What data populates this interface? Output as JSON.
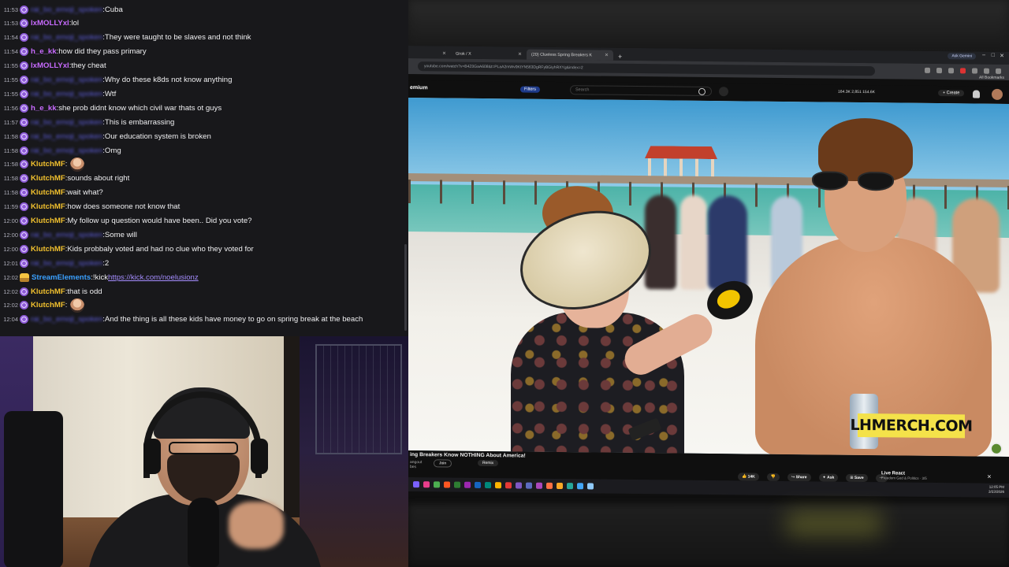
{
  "chat": {
    "messages": [
      {
        "time": "11:53",
        "user": "rai_bo_emoji_spoken",
        "hidden": true,
        "color": "#5b5bd6",
        "text": "Cuba"
      },
      {
        "time": "11:53",
        "user": "lxMOLLYxl",
        "hidden": false,
        "color": "#c86bff",
        "text": "lol"
      },
      {
        "time": "11:54",
        "user": "rai_bo_emoji_spoken",
        "hidden": true,
        "color": "#5b5bd6",
        "text": "They were taught to be slaves and not think"
      },
      {
        "time": "11:54",
        "user": "h_e_kk",
        "hidden": false,
        "color": "#c86bff",
        "text": "how did they pass primary"
      },
      {
        "time": "11:55",
        "user": "lxMOLLYxl",
        "hidden": false,
        "color": "#c86bff",
        "text": "they cheat"
      },
      {
        "time": "11:55",
        "user": "rai_bo_emoji_spoken",
        "hidden": true,
        "color": "#5b5bd6",
        "text": "Why do these k8ds not know anything"
      },
      {
        "time": "11:55",
        "user": "rai_bo_emoji_spoken",
        "hidden": true,
        "color": "#5b5bd6",
        "text": "Wtf"
      },
      {
        "time": "11:56",
        "user": "h_e_kk",
        "hidden": false,
        "color": "#c86bff",
        "text": "she prob didnt know which civil war thats ot guys"
      },
      {
        "time": "11:57",
        "user": "rai_bo_emoji_spoken",
        "hidden": true,
        "color": "#5b5bd6",
        "text": "This is embarrassing"
      },
      {
        "time": "11:58",
        "user": "rai_bo_emoji_spoken",
        "hidden": true,
        "color": "#5b5bd6",
        "text": "Our education system is broken"
      },
      {
        "time": "11:58",
        "user": "rai_bo_emoji_spoken",
        "hidden": true,
        "color": "#5b5bd6",
        "text": "Omg"
      },
      {
        "time": "11:58",
        "user": "KlutchMF",
        "hidden": false,
        "color": "#f2c12e",
        "text": "",
        "emote": true
      },
      {
        "time": "11:58",
        "user": "KlutchMF",
        "hidden": false,
        "color": "#f2c12e",
        "text": "sounds about right"
      },
      {
        "time": "11:58",
        "user": "KlutchMF",
        "hidden": false,
        "color": "#f2c12e",
        "text": "wait what?"
      },
      {
        "time": "11:59",
        "user": "KlutchMF",
        "hidden": false,
        "color": "#f2c12e",
        "text": "how does someone not know that"
      },
      {
        "time": "12:00",
        "user": "KlutchMF",
        "hidden": false,
        "color": "#f2c12e",
        "text": "My follow up question would have been.. Did you vote?"
      },
      {
        "time": "12:00",
        "user": "rai_bo_emoji_spoken",
        "hidden": true,
        "color": "#5b5bd6",
        "text": "Some will"
      },
      {
        "time": "12:00",
        "user": "KlutchMF",
        "hidden": false,
        "color": "#f2c12e",
        "text": "Kids probbaly voted and had no clue who they voted for"
      },
      {
        "time": "12:01",
        "user": "rai_bo_emoji_spoken",
        "hidden": true,
        "color": "#5b5bd6",
        "text": "2"
      },
      {
        "time": "12:02",
        "user": "StreamElements",
        "hidden": false,
        "color": "#3aa0ff",
        "text": "!kick",
        "link": "https://kick.com/noelusionz",
        "bot": true
      },
      {
        "time": "12:02",
        "user": "KlutchMF",
        "hidden": false,
        "color": "#f2c12e",
        "text": "that is odd"
      },
      {
        "time": "12:02",
        "user": "KlutchMF",
        "hidden": false,
        "color": "#f2c12e",
        "text": "",
        "emote": true
      },
      {
        "time": "12:04",
        "user": "rai_bo_emoji_spoken",
        "hidden": true,
        "color": "#5b5bd6",
        "text": "And the thing is all these kids have money to go on spring break at the beach"
      }
    ]
  },
  "browser": {
    "tabs": [
      {
        "label": "",
        "active": false
      },
      {
        "label": "Grok / X",
        "active": false
      },
      {
        "label": "(20) Clueless Spring Breakers K",
        "active": true
      }
    ],
    "ask_gemini": "Ask Gemini",
    "url": "youtube.com/watch?v=B4Z0GaA608&t=PLaA2mWv0KtYN563DgRFyBGiyhRXYg&index=2",
    "bookmarks": "All Bookmarks"
  },
  "youtube": {
    "logo_text": "emium",
    "filters": "Filters",
    "search_placeholder": "Search",
    "stats": "164.3K  2,851  154.6K",
    "create": "+ Create",
    "video_title": "ing Breakers Know NOTHING About America!",
    "channel": "angout",
    "channel_sub": "bes",
    "join": "Join",
    "remix": "Remix",
    "like_count": "14K",
    "share": "Share",
    "ask": "Ask",
    "save": "Save",
    "live_react_title": "Live React",
    "live_react_sub": "Freedom God & Politics · 3/5",
    "merch_overlay": "LHMERCH.COM"
  },
  "taskbar": {
    "time": "12:05 PM",
    "date": "3/23/2026",
    "icon_colors": [
      "#7b61ff",
      "#e83e8c",
      "#4caf50",
      "#ff5722",
      "#2e7d32",
      "#9c27b0",
      "#1565c0",
      "#00897b",
      "#ffb300",
      "#e53935",
      "#7e57c2",
      "#5c6bc0",
      "#ab47bc",
      "#ff7043",
      "#f9a825",
      "#26a69a",
      "#42a5f5",
      "#90caf9"
    ]
  }
}
